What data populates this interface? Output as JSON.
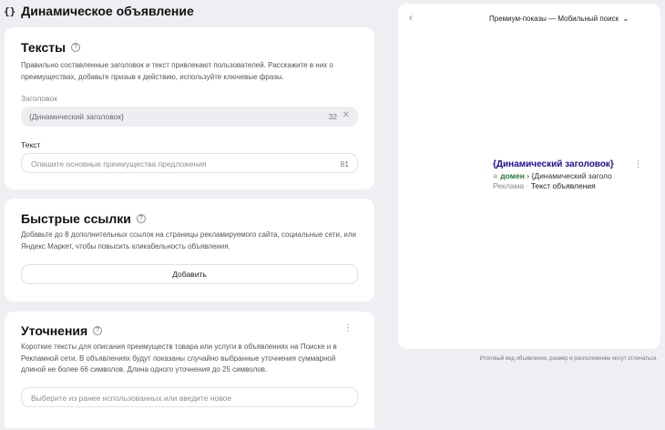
{
  "page": {
    "header_icon": "{}",
    "title": "Динамическое объявление"
  },
  "texts_section": {
    "title": "Тексты",
    "description": "Правильно составленные заголовок и текст привлекают пользователей. Расскажите в них о преимуществах, добавьте призыв к действию, используйте ключевые фразы.",
    "headline_label": "Заголовок",
    "headline_value": "{Динамический заголовок}",
    "headline_counter": "32",
    "text_label": "Текст",
    "text_placeholder": "Опишите основные преимущества предложения",
    "text_counter": "81"
  },
  "quick_links_section": {
    "title": "Быстрые ссылки",
    "description": "Добавьте до 8 дополнительных ссылок на страницы рекламируемого сайта, социальные сети, или Яндекс Маркет, чтобы повысить кликабельность объявления.",
    "add_button": "Добавить"
  },
  "refinements_section": {
    "title": "Уточнения",
    "description": "Короткие тексты для описания преимуществ товара или услуги в объявлениях на Поиске и в Рекламной сети. В объявлениях будут показаны случайно выбранные уточнения суммарной длиной не более 66 символов. Длина одного уточнения до 25 символов.",
    "input_placeholder": "Выберите из ранее использованных или введите новое"
  },
  "preview": {
    "format_label": "Премиум-показы — Мобильный поиск",
    "ad": {
      "title": "{Динамический заголовок}",
      "domain": "домен",
      "separator": "›",
      "path": "{Динамический заголо",
      "label": "Реклама",
      "dot": "·",
      "text": "Текст объявления"
    },
    "footnote": "Итоговый вид объявления, размер и расположение могут отличаться."
  },
  "icons": {
    "help": "help-circle-icon",
    "clear": "close-icon",
    "back": "chevron-left-icon",
    "dropdown": "chevron-down-icon",
    "more": "kebab-menu-icon",
    "globe": "globe-icon"
  }
}
